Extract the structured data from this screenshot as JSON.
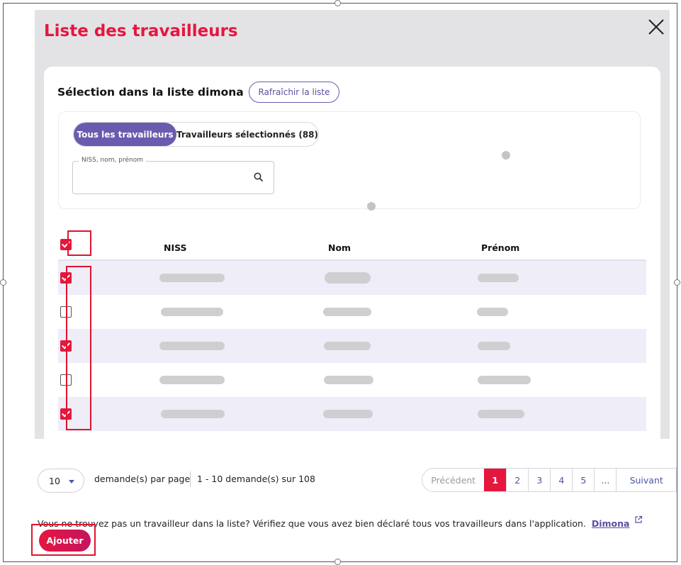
{
  "dialog": {
    "title": "Liste des travailleurs",
    "card_title": "Sélection dans la liste dimona",
    "refresh_label": "Rafraîchir la liste",
    "tabs": [
      {
        "label": "Tous les travailleurs",
        "active": true
      },
      {
        "label": "Travailleurs sélectionnés (88)",
        "active": false
      }
    ],
    "search": {
      "label": "NISS, nom, prénom",
      "value": ""
    },
    "table": {
      "headers": [
        "NISS",
        "Nom",
        "Prénom"
      ],
      "select_all_checked": true,
      "rows_checked": [
        true,
        false,
        true,
        false,
        true
      ]
    }
  },
  "pagination": {
    "page_size": "10",
    "per_page_label": "demande(s) par page",
    "range_label": "1 - 10 demande(s) sur 108",
    "prev_label": "Précédent",
    "pages": [
      "1",
      "2",
      "3",
      "4",
      "5",
      "..."
    ],
    "current_page": "1",
    "next_label": "Suivant"
  },
  "footer": {
    "notice": "Vous ne trouvez pas un travailleur dans la liste? Vérifiez que vous avez bien déclaré tous vos travailleurs dans l'application.",
    "link": "Dimona",
    "add_label": "Ajouter"
  },
  "colors": {
    "brand_red": "#e5173f",
    "brand_purple": "#6b5bae",
    "row_shade": "#eeedf8"
  }
}
